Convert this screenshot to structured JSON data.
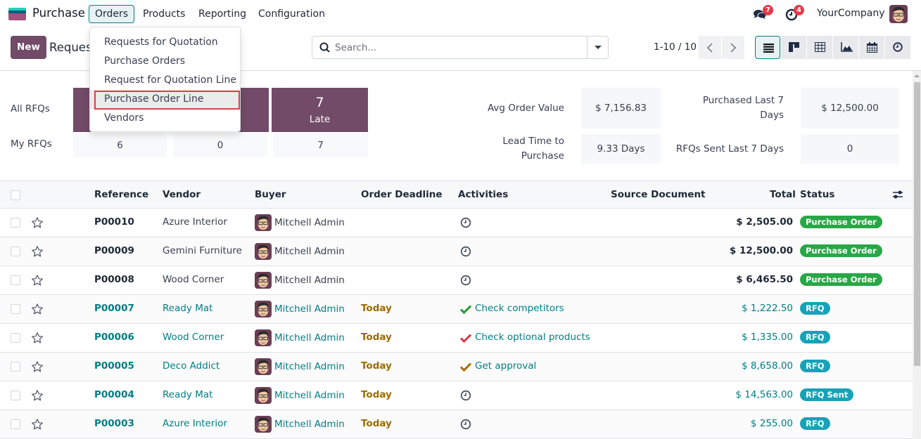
{
  "navbar": {
    "app_name": "Purchase",
    "menus": [
      {
        "label": "Orders",
        "active": true
      },
      {
        "label": "Products"
      },
      {
        "label": "Reporting"
      },
      {
        "label": "Configuration"
      }
    ],
    "messages_badge": "7",
    "activities_badge": "4",
    "company": "YourCompany"
  },
  "orders_menu": {
    "items": [
      {
        "label": "Requests for Quotation"
      },
      {
        "label": "Purchase Orders"
      },
      {
        "label": "Request for Quotation Line"
      },
      {
        "label": "Purchase Order Line",
        "highlighted": true
      },
      {
        "label": "Vendors"
      }
    ]
  },
  "control_panel": {
    "new_label": "New",
    "title": "Requests for Quotation",
    "search_placeholder": "Search...",
    "pager": "1-10 / 10",
    "views": [
      "list",
      "kanban",
      "pivot",
      "graph",
      "calendar",
      "activity"
    ],
    "active_view": "list"
  },
  "dashboard": {
    "row_labels": {
      "all": "All RFQs",
      "my": "My RFQs"
    },
    "tiles": [
      {
        "all_value": "",
        "label": "",
        "my_value": "6"
      },
      {
        "all_value": "",
        "label": "",
        "my_value": "0"
      },
      {
        "all_value": "7",
        "label": "Late",
        "my_value": "7"
      }
    ],
    "stats": {
      "avg_order_value": {
        "label": "Avg Order Value",
        "value": "$ 7,156.83"
      },
      "purchased_last_7": {
        "label_l1": "Purchased Last 7",
        "label_l2": "Days",
        "value": "$ 12,500.00"
      },
      "lead_time": {
        "label_l1": "Lead Time to",
        "label_l2": "Purchase",
        "value": "9.33 Days"
      },
      "rfqs_sent_last_7": {
        "label": "RFQs Sent Last 7 Days",
        "value": "0"
      }
    }
  },
  "list": {
    "columns": {
      "reference": "Reference",
      "vendor": "Vendor",
      "buyer": "Buyer",
      "order_deadline": "Order Deadline",
      "activities": "Activities",
      "source_document": "Source Document",
      "total": "Total",
      "status": "Status"
    },
    "rows": [
      {
        "reference": "P00010",
        "vendor": "Azure Interior",
        "buyer": "Mitchell Admin",
        "deadline": "",
        "activity": "",
        "activity_icon": "clock",
        "total": "$ 2,505.00",
        "status": "Purchase Order",
        "kind": "po"
      },
      {
        "reference": "P00009",
        "vendor": "Gemini Furniture",
        "buyer": "Mitchell Admin",
        "deadline": "",
        "activity": "",
        "activity_icon": "clock",
        "total": "$ 12,500.00",
        "status": "Purchase Order",
        "kind": "po"
      },
      {
        "reference": "P00008",
        "vendor": "Wood Corner",
        "buyer": "Mitchell Admin",
        "deadline": "",
        "activity": "",
        "activity_icon": "clock",
        "total": "$ 6,465.50",
        "status": "Purchase Order",
        "kind": "po"
      },
      {
        "reference": "P00007",
        "vendor": "Ready Mat",
        "buyer": "Mitchell Admin",
        "deadline": "Today",
        "activity": "Check competitors",
        "activity_icon": "check-green",
        "total": "$ 1,222.50",
        "status": "RFQ",
        "kind": "rfq"
      },
      {
        "reference": "P00006",
        "vendor": "Wood Corner",
        "buyer": "Mitchell Admin",
        "deadline": "Today",
        "activity": "Check optional products",
        "activity_icon": "check-red",
        "total": "$ 1,335.00",
        "status": "RFQ",
        "kind": "rfq"
      },
      {
        "reference": "P00005",
        "vendor": "Deco Addict",
        "buyer": "Mitchell Admin",
        "deadline": "Today",
        "activity": "Get approval",
        "activity_icon": "check-orange",
        "total": "$ 8,658.00",
        "status": "RFQ",
        "kind": "rfq"
      },
      {
        "reference": "P00004",
        "vendor": "Ready Mat",
        "buyer": "Mitchell Admin",
        "deadline": "Today",
        "activity": "",
        "activity_icon": "clock",
        "total": "$ 14,563.00",
        "status": "RFQ Sent",
        "kind": "rfq"
      },
      {
        "reference": "P00003",
        "vendor": "Azure Interior",
        "buyer": "Mitchell Admin",
        "deadline": "Today",
        "activity": "",
        "activity_icon": "clock",
        "total": "$ 255.00",
        "status": "RFQ",
        "kind": "rfq"
      }
    ]
  },
  "colors": {
    "brand": "#714b67",
    "accent": "#017e84",
    "po_badge": "#28a745",
    "rfq_badge": "#17a2b8",
    "deadline": "#9a6b01",
    "badge_red": "#e33b48",
    "check_green": "#1e9a2e",
    "check_red": "#dc3545",
    "check_orange": "#a86b04"
  }
}
